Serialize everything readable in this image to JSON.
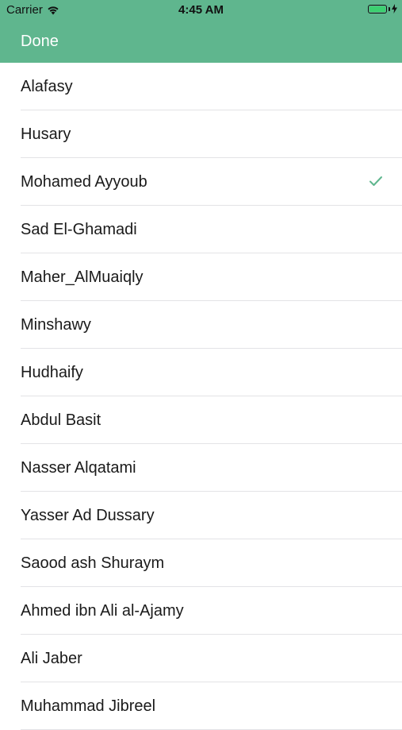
{
  "status_bar": {
    "carrier": "Carrier",
    "time": "4:45 AM",
    "battery_level": 1.0
  },
  "nav": {
    "done_label": "Done"
  },
  "accent_color": "#5fb68e",
  "reciters": [
    {
      "label": "Alafasy",
      "selected": false
    },
    {
      "label": "Husary",
      "selected": false
    },
    {
      "label": "Mohamed Ayyoub",
      "selected": true
    },
    {
      "label": "Sad El-Ghamadi",
      "selected": false
    },
    {
      "label": "Maher_AlMuaiqly",
      "selected": false
    },
    {
      "label": "Minshawy",
      "selected": false
    },
    {
      "label": "Hudhaify",
      "selected": false
    },
    {
      "label": "Abdul Basit",
      "selected": false
    },
    {
      "label": "Nasser Alqatami",
      "selected": false
    },
    {
      "label": "Yasser Ad Dussary",
      "selected": false
    },
    {
      "label": "Saood ash Shuraym",
      "selected": false
    },
    {
      "label": "Ahmed ibn Ali al-Ajamy",
      "selected": false
    },
    {
      "label": "Ali Jaber",
      "selected": false
    },
    {
      "label": "Muhammad Jibreel",
      "selected": false
    }
  ]
}
